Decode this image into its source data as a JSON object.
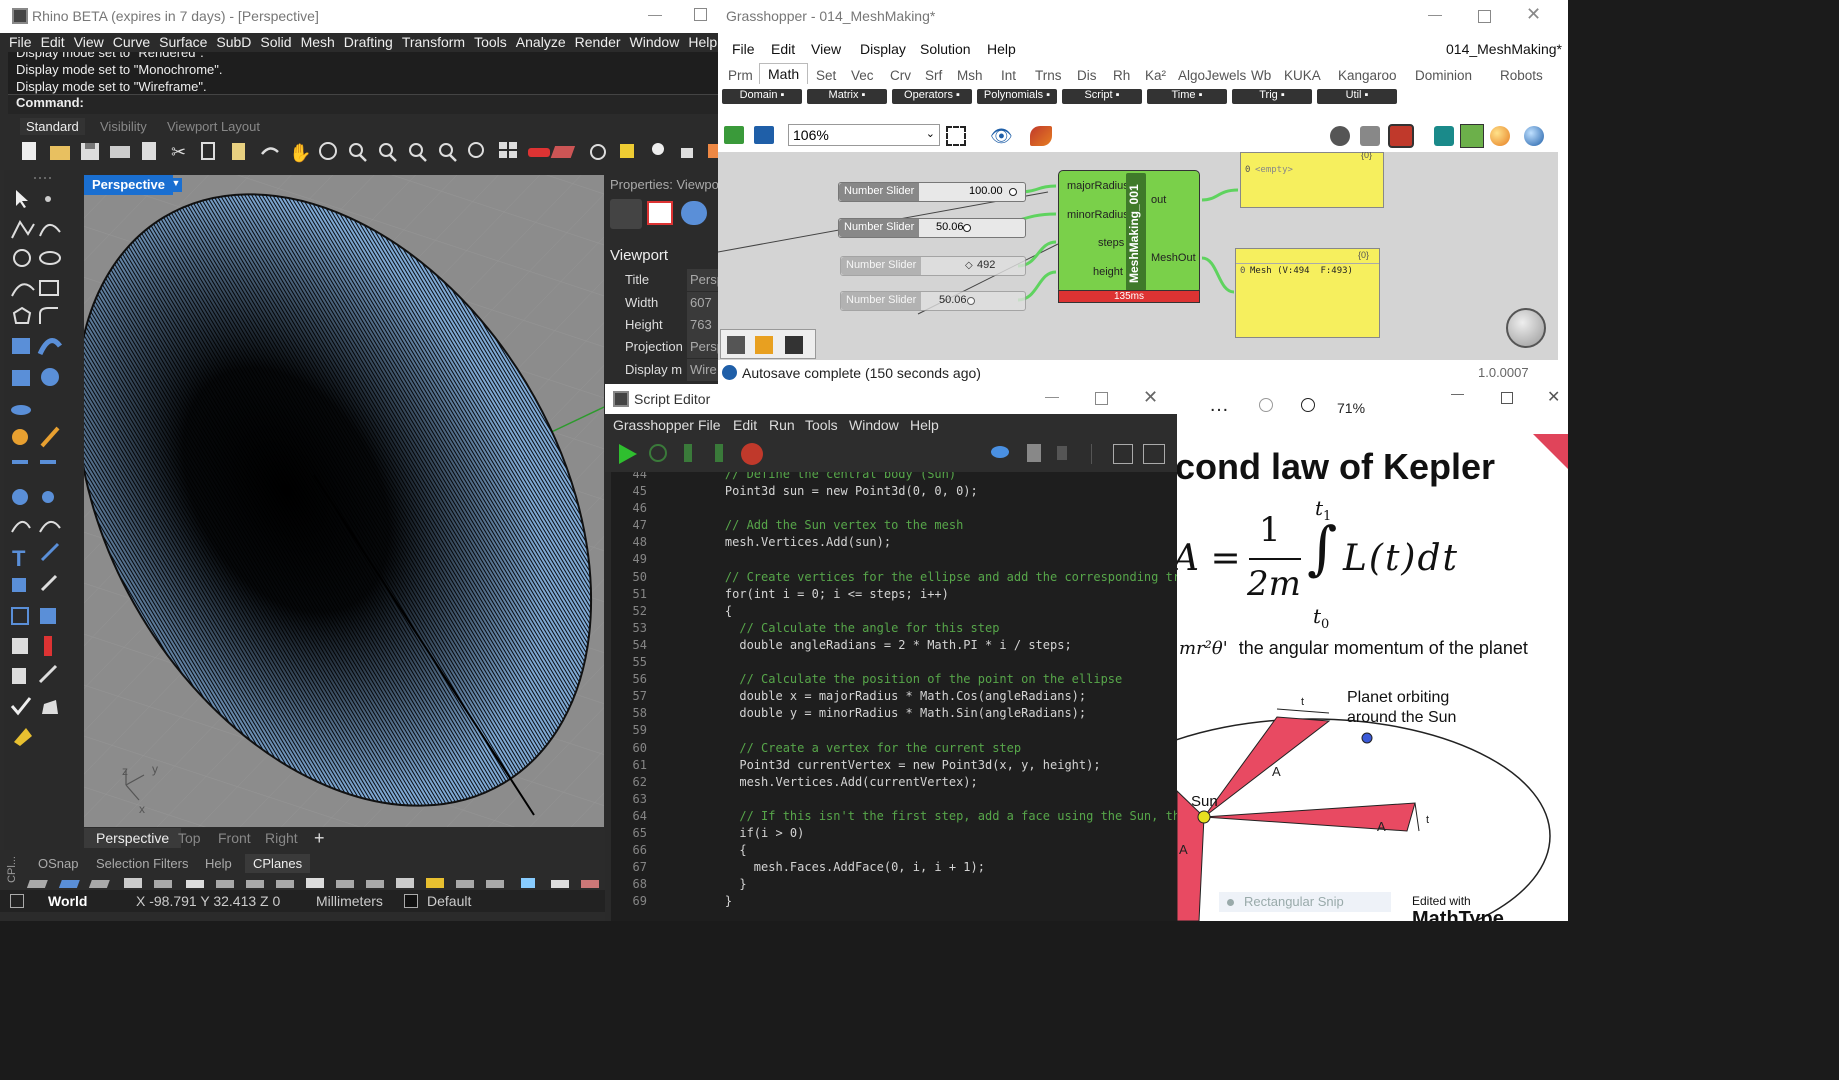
{
  "rhino": {
    "title": "Rhino BETA (expires in 7 days) - [Perspective]",
    "menu": [
      "File",
      "Edit",
      "View",
      "Curve",
      "Surface",
      "SubD",
      "Solid",
      "Mesh",
      "Drafting",
      "Transform",
      "Tools",
      "Analyze",
      "Render",
      "Window",
      "Help"
    ],
    "history": [
      "Display mode set to \"Rendered\".",
      "Display mode set to \"Monochrome\".",
      "Display mode set to \"Wireframe\"."
    ],
    "command_label": "Command:",
    "toolbar_tabs": [
      "Standard",
      "Visibility",
      "Viewport Layout"
    ],
    "viewport_label": "Perspective",
    "view_tabs": [
      "Perspective",
      "Top",
      "Front",
      "Right",
      "+"
    ],
    "status_tabs": [
      "OSnap",
      "Selection Filters",
      "Help",
      "CPlanes"
    ],
    "cplane_label": "CPl...",
    "status": {
      "cplane": "World",
      "coords": "X -98.791 Y 32.413 Z 0",
      "units": "Millimeters",
      "layer": "Default"
    },
    "axis": {
      "z": "z",
      "y": "y",
      "x": "x"
    },
    "props": {
      "header": "Properties: Viewpo",
      "section": "Viewport",
      "rows": [
        {
          "k": "Title",
          "v": "Persp"
        },
        {
          "k": "Width",
          "v": "607"
        },
        {
          "k": "Height",
          "v": "763"
        },
        {
          "k": "Projection",
          "v": "Persp"
        },
        {
          "k": "Display m",
          "v": "Wire"
        }
      ]
    }
  },
  "gh": {
    "title": "Grasshopper - 014_MeshMaking*",
    "menu": [
      "File",
      "Edit",
      "View",
      "Display",
      "Solution",
      "Help"
    ],
    "doc_name": "014_MeshMaking*",
    "tabs": [
      "Prm",
      "Math",
      "Set",
      "Vec",
      "Crv",
      "Srf",
      "Msh",
      "Int",
      "Trns",
      "Dis",
      "Rh",
      "Ka²",
      "AlgoJewels",
      "Wb",
      "KUKA",
      "Kangaroo",
      "Dominion",
      "Robots"
    ],
    "active_tab": "Math",
    "categories": [
      "Domain",
      "Matrix",
      "Operators",
      "Polynomials",
      "Script",
      "Time",
      "Trig",
      "Util"
    ],
    "zoom": "106%",
    "sliders": [
      {
        "label": "Number Slider",
        "value": "100.00",
        "fill": 1.0
      },
      {
        "label": "Number Slider",
        "value": "50.06",
        "fill": 0.5
      },
      {
        "label": "Number Slider",
        "value": "492",
        "fill": 0.49
      },
      {
        "label": "Number Slider",
        "value": "50.06",
        "fill": 0.5
      }
    ],
    "component": {
      "name": "MeshMaking_001",
      "inputs": [
        "majorRadius",
        "minorRadius",
        "steps",
        "height"
      ],
      "outputs": [
        "out",
        "MeshOut"
      ],
      "time": "135ms"
    },
    "panels": [
      {
        "index": "0",
        "content": "<empty>",
        "path": "{0}"
      },
      {
        "index": "0",
        "content": "Mesh (V:494  F:493)",
        "path": "{0}"
      }
    ],
    "status": "Autosave complete (150 seconds ago)",
    "version": "1.0.0007"
  },
  "script_editor": {
    "title": "Script Editor",
    "menu": [
      "Grasshopper",
      "File",
      "Edit",
      "Run",
      "Tools",
      "Window",
      "Help"
    ],
    "lines": [
      {
        "n": "44",
        "t": "    // Define the central body (Sun)",
        "c": "comment"
      },
      {
        "n": "45",
        "t": "    Point3d sun = new Point3d(0, 0, 0);",
        "c": "code"
      },
      {
        "n": "46",
        "t": "",
        "c": "code"
      },
      {
        "n": "47",
        "t": "    // Add the Sun vertex to the mesh",
        "c": "comment"
      },
      {
        "n": "48",
        "t": "    mesh.Vertices.Add(sun);",
        "c": "code"
      },
      {
        "n": "49",
        "t": "",
        "c": "code"
      },
      {
        "n": "50",
        "t": "    // Create vertices for the ellipse and add the corresponding triangu",
        "c": "comment"
      },
      {
        "n": "51",
        "t": "    for(int i = 0; i <= steps; i++)",
        "c": "code"
      },
      {
        "n": "52",
        "t": "    {",
        "c": "code"
      },
      {
        "n": "53",
        "t": "      // Calculate the angle for this step",
        "c": "comment"
      },
      {
        "n": "54",
        "t": "      double angleRadians = 2 * Math.PI * i / steps;",
        "c": "code"
      },
      {
        "n": "55",
        "t": "",
        "c": "code"
      },
      {
        "n": "56",
        "t": "      // Calculate the position of the point on the ellipse",
        "c": "comment"
      },
      {
        "n": "57",
        "t": "      double x = majorRadius * Math.Cos(angleRadians);",
        "c": "code"
      },
      {
        "n": "58",
        "t": "      double y = minorRadius * Math.Sin(angleRadians);",
        "c": "code"
      },
      {
        "n": "59",
        "t": "",
        "c": "code"
      },
      {
        "n": "60",
        "t": "      // Create a vertex for the current step",
        "c": "comment"
      },
      {
        "n": "61",
        "t": "      Point3d currentVertex = new Point3d(x, y, height);",
        "c": "code"
      },
      {
        "n": "62",
        "t": "      mesh.Vertices.Add(currentVertex);",
        "c": "code"
      },
      {
        "n": "63",
        "t": "",
        "c": "code"
      },
      {
        "n": "64",
        "t": "      // If this isn't the first step, add a face using the Sun, the pre",
        "c": "comment"
      },
      {
        "n": "65",
        "t": "      if(i > 0)",
        "c": "code"
      },
      {
        "n": "66",
        "t": "      {",
        "c": "code"
      },
      {
        "n": "67",
        "t": "        mesh.Faces.AddFace(0, i, i + 1);",
        "c": "code"
      },
      {
        "n": "68",
        "t": "      }",
        "c": "code"
      },
      {
        "n": "69",
        "t": "    }",
        "c": "code"
      }
    ]
  },
  "pdf": {
    "zoom": "71%",
    "more": "…",
    "heading": "cond law of Kepler",
    "formula": {
      "lhs": "A =",
      "num": "1",
      "den": "2m",
      "t_top": "t",
      "t_top_sub": "1",
      "t_bot": "t",
      "t_bot_sub": "0",
      "integrand": "L(t)dt"
    },
    "momentum_formula": "mr²θ'",
    "momentum_text": "the angular momentum of the planet",
    "diagram": {
      "planet_label_1": "Planet orbiting",
      "planet_label_2": "around the Sun",
      "sun_label": "Sun",
      "area_label": "A",
      "t_label": "t"
    },
    "snip_label": "Rectangular Snip",
    "footer_1": "Edited with",
    "footer_2": "MathType"
  }
}
